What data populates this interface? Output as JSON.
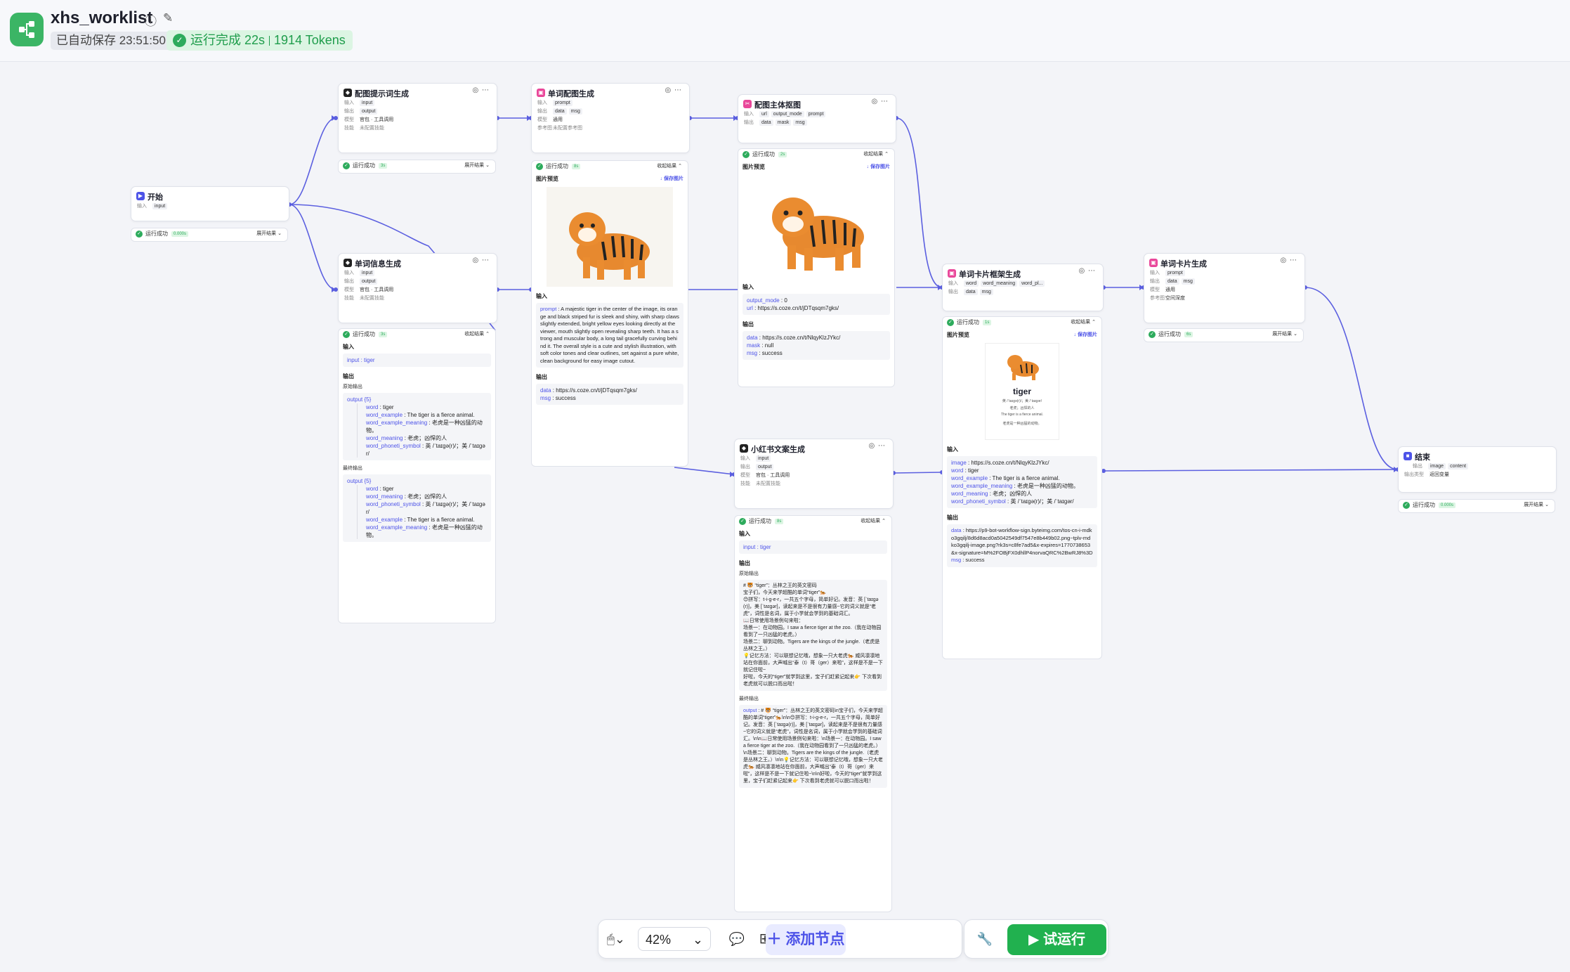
{
  "header": {
    "title": "xhs_worklist",
    "autosave": "已自动保存 23:51:50",
    "run_status": "运行完成 22s",
    "run_tokens": "1914 Tokens"
  },
  "labels": {
    "input": "输入",
    "output": "输出",
    "model": "模型",
    "skill": "技能",
    "ref": "参考图",
    "output_type": "输出类型",
    "img_preview": "图片预览",
    "save_img": "↓ 保存图片",
    "run_ok": "运行成功",
    "expand": "展开结果 ⌄",
    "collapse": "收起结果 ⌃",
    "raw_output": "原始输出",
    "final_output": "最终输出",
    "tools": "官包 · 工具调用",
    "no_skill": "未配置技能",
    "no_ref": "未配置参考图",
    "general": "通用",
    "space_depth": "空间深度",
    "return_var": "返回变量"
  },
  "vars": {
    "input": "input",
    "output": "output",
    "prompt": "prompt",
    "data": "data",
    "msg": "msg",
    "url": "url",
    "output_mode": "output_mode",
    "mask": "mask",
    "image": "image",
    "content": "content",
    "word": "word",
    "word_meaning": "word_meaning",
    "word_pl": "word_pl..."
  },
  "nodes": {
    "start": {
      "title": "开始",
      "time": "0.000s"
    },
    "prompt_gen": {
      "title": "配图提示词生成",
      "time": "3s"
    },
    "word_img": {
      "title": "单词配图生成",
      "time": "8s"
    },
    "subject": {
      "title": "配图主体抠图",
      "time": "2s"
    },
    "word_info": {
      "title": "单词信息生成",
      "time": "3s"
    },
    "xhs": {
      "title": "小红书文案生成",
      "time": "8s"
    },
    "card_frame": {
      "title": "单词卡片框架生成",
      "time": "1s"
    },
    "card_gen": {
      "title": "单词卡片生成",
      "time": "6s"
    },
    "end": {
      "title": "结束",
      "time": "0.000s"
    }
  },
  "word_info_result": {
    "input_line": "input : tiger",
    "output_count": "output {5}",
    "raw": [
      {
        "k": "word",
        "v": " : tiger"
      },
      {
        "k": "word_example",
        "v": " : The tiger is a fierce animal."
      },
      {
        "k": "word_example_meaning",
        "v": " : 老虎是一种凶猛的动物。"
      },
      {
        "k": "word_meaning",
        "v": " : 老虎；凶悍的人"
      },
      {
        "k": "word_phoneti_symbol",
        "v": " : 英 /ˈtaɪɡə(r)/；美 /ˈtaɪɡər/"
      }
    ],
    "final": [
      {
        "k": "word",
        "v": " : tiger"
      },
      {
        "k": "word_meaning",
        "v": " : 老虎；凶悍的人"
      },
      {
        "k": "word_phoneti_symbol",
        "v": " : 英 /ˈtaɪɡə(r)/；美 /ˈtaɪɡər/"
      },
      {
        "k": "word_example",
        "v": " : The tiger is a fierce animal."
      },
      {
        "k": "word_example_meaning",
        "v": " : 老虎是一种凶猛的动物。"
      }
    ]
  },
  "word_img_result": {
    "prompt_key": "prompt",
    "prompt_text": " : A majestic tiger in the center of the image, its orange and black striped fur is sleek and shiny, with sharp claws slightly extended, bright yellow eyes looking directly at the viewer, mouth slightly open revealing sharp teeth. It has a strong and muscular body, a long tail gracefully curving behind it. The overall style is a cute and stylish illustration, with soft color tones and clear outlines, set against a pure white, clean background for easy image cutout.",
    "data_line": " : https://s.coze.cn/t/jDTqsqm7gks/",
    "msg_line": " : success"
  },
  "subject_result": {
    "in_mode": " : 0",
    "in_url": " : https://s.coze.cn/t/jDTqsqm7gks/",
    "out_data": " : https://s.coze.cn/t/NlqyKlzJYkc/",
    "out_mask": " : null",
    "out_msg": " : success"
  },
  "xhs_result": {
    "input_line": "input : tiger",
    "raw_text": "# 🐯 “tiger”：丛林之王的英文密码\n宝子们，今天来学超酷的单词“tiger”🐅\n😊拼写：t-i-g-e-r，一共五个字母，简单好记。发音：英 [ˈtaɪɡə(r)]，美 [ˈtaɪɡər]，读起来是不是很有力量感~它的词义就是“老虎”，词性是名词，属于小学就会学到的基础词汇。\n📖日常使用场景例句来啦：\n场景一：在动物园。I saw a fierce tiger at the zoo.（我在动物园看到了一只凶猛的老虎。）\n场景二：聊到动物。Tigers are the kings of the jungle.（老虎是丛林之王。）\n💡记忆方法：可以联想记忆哦，想象一只大老虎🐅 威风凛凛地站在你面前，大声喊出“泰（t）哥（ger）来啦”，这样是不是一下就记住啦~\n好啦，今天的“tiger”就学到这里，宝子们赶紧记起来👉 下次看到老虎就可以脱口而出啦！",
    "final_text": " : # 🐯 “tiger”：丛林之王的英文密码\\n宝子们，今天来学超酷的单词“tiger”🐅\\n\\n😊拼写：t-i-g-e-r，一共五个字母，简单好记。发音：英 [ˈtaɪɡə(r)]，美 [ˈtaɪɡər]，读起来是不是很有力量感~它的词义就是“老虎”，词性是名词，属于小学就会学到的基础词汇。\\n\\n📖日常使用场景例句来啦：\\n场景一：在动物园。I saw a fierce tiger at the zoo.（我在动物园看到了一只凶猛的老虎。）\\n场景二：聊到动物。Tigers are the kings of the jungle.（老虎是丛林之王。）\\n\\n💡记忆方法：可以联想记忆哦，想象一只大老虎🐅 威风凛凛地站在你面前，大声喊出“泰（t）哥（ger）来啦”，这样是不是一下就记住啦~\\n\\n好啦，今天的“tiger”就学到这里，宝子们赶紧记起来👉 下次看到老虎就可以脱口而出啦！"
  },
  "card_frame_result": {
    "card_word": "tiger",
    "card_l1": "英 /ˈtaɪɡə(r)/；美 /ˈtaɪɡər/",
    "card_l2": "老虎；凶悍的人",
    "card_l3": "The tiger is a fierce animal.",
    "card_l4": "老虎是一种凶猛的动物。",
    "in_image": " : https://s.coze.cn/t/NlqyKlzJYkc/",
    "in_word": " : tiger",
    "in_example": " : The tiger is a fierce animal.",
    "in_example_meaning": " : 老虎是一种凶猛的动物。",
    "in_meaning": " : 老虎；凶悍的人",
    "in_phonetic": " : 英 /ˈtaɪɡə(r)/；美 /ˈtaɪɡər/",
    "out_data": " : https://p9-bot-workflow-sign.byteimg.com/tos-cn-i-mdko3gqilj/8d6d8acd0a5042549df7547e8b449b02.png~tplv-mdko3gqilj-image.png?rk3s=c8fe7ad5&x-expires=1770738653&x-signature=M%2FOBjFX0dhllP4norvaQRC%2BwRJ8%3D",
    "out_msg": " : success",
    "k_image": "image",
    "k_word": "word",
    "k_example": "word_example",
    "k_example_meaning": "word_example_meaning",
    "k_meaning": "word_meaning",
    "k_phonetic": "word_phoneti_symbol"
  },
  "toolbar": {
    "zoom": "42%",
    "add_node": "添加节点",
    "trial_run": "试运行"
  },
  "colors": {
    "accent": "#4d53e8",
    "success": "#2dab5c",
    "edge": "#5b5fe0",
    "brand": "#3bb565"
  }
}
